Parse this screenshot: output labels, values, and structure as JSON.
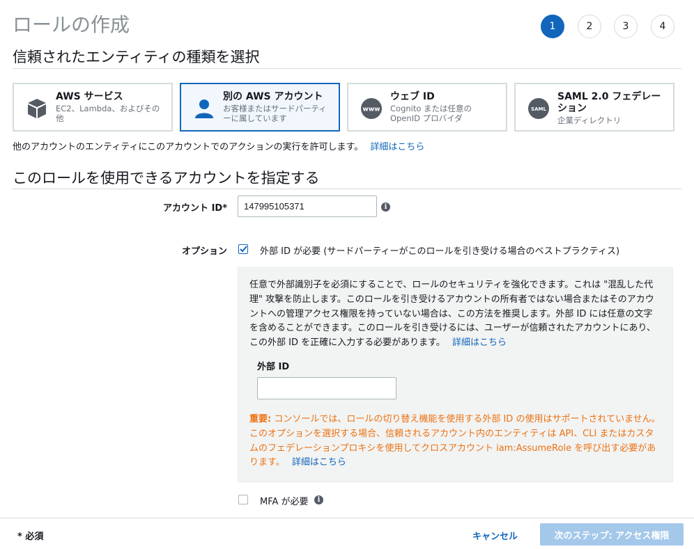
{
  "page_title": "ロールの作成",
  "steps": [
    "1",
    "2",
    "3",
    "4"
  ],
  "section1_title": "信頼されたエンティティの種類を選択",
  "cards": [
    {
      "title": "AWS サービス",
      "subtitle": "EC2、Lambda、およびその他",
      "icon": "cube-icon"
    },
    {
      "title": "別の AWS アカウント",
      "subtitle": "お客様またはサードパーティーに属しています",
      "icon": "user-icon"
    },
    {
      "title": "ウェブ ID",
      "subtitle": "Cognito または任意の OpenID プロバイダ",
      "icon": "www-icon"
    },
    {
      "title": "SAML 2.0 フェデレーション",
      "subtitle": "企業ディレクトリ",
      "icon": "saml-icon"
    }
  ],
  "card_icon_text": {
    "www": "www",
    "saml": "SAML"
  },
  "description": "他のアカウントのエンティティにこのアカウントでのアクションの実行を許可します。",
  "learn_more": "詳細はこちら",
  "section2_title": "このロールを使用できるアカウントを指定する",
  "account_id_label": "アカウント ID*",
  "account_id_value": "147995105371",
  "options_label": "オプション",
  "external_id_checkbox_label": "外部 ID が必要 (サードパーティーがこのロールを引き受ける場合のベストプラクティス)",
  "external_id_checked": true,
  "external_id_paragraph": "任意で外部識別子を必須にすることで、ロールのセキュリティを強化できます。これは \"混乱した代理\" 攻撃を防止します。このロールを引き受けるアカウントの所有者ではない場合またはそのアカウントへの管理アクセス権限を持っていない場合は、この方法を推奨します。外部 ID には任意の文字を含めることができます。このロールを引き受けるには、ユーザーが信頼されたアカウントにあり、この外部 ID を正確に入力する必要があります。",
  "external_id_field_label": "外部 ID",
  "external_id_value": "",
  "warning_prefix": "重要:",
  "warning_text": "コンソールでは、ロールの切り替え機能を使用する外部 ID の使用はサポートされていません。このオプションを選択する場合、信頼されるアカウント内のエンティティは API、CLI またはカスタムのフェデレーションプロキシを使用してクロスアカウント iam:AssumeRole を呼び出す必要があります。",
  "mfa_label": "MFA が必要",
  "mfa_checked": false,
  "required_note": "* 必須",
  "cancel_label": "キャンセル",
  "next_label": "次のステップ: アクセス権限",
  "colors": {
    "accent": "#1166bb",
    "warning": "#ec7211",
    "disabled_primary": "#a4c8ea"
  }
}
